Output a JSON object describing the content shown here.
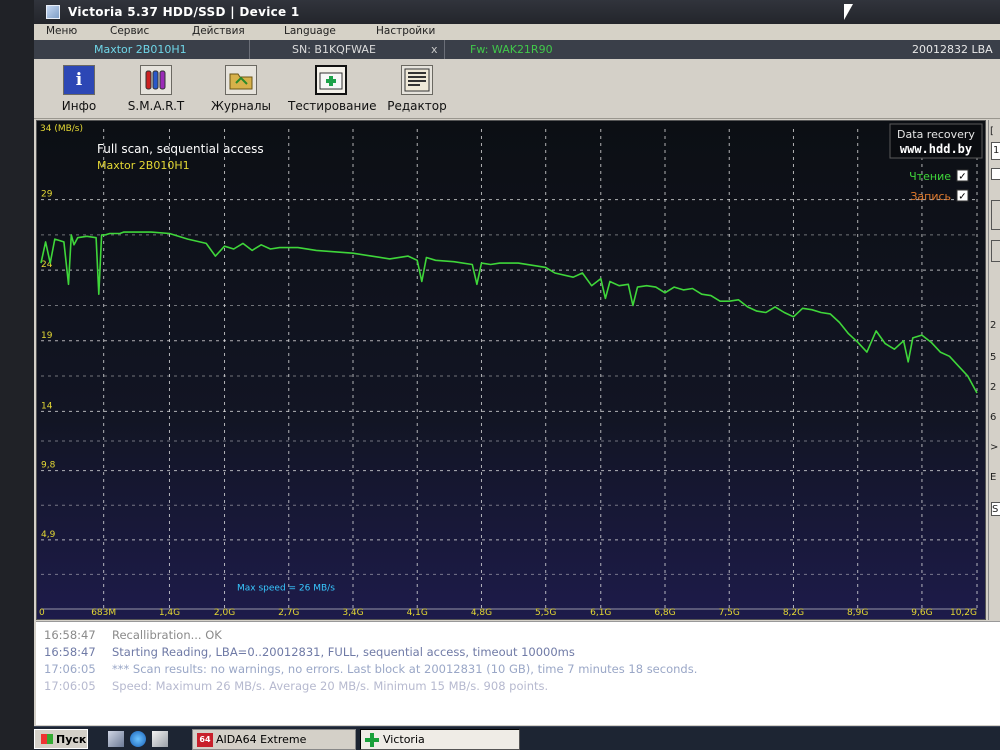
{
  "window": {
    "title": "Victoria 5.37 HDD/SSD | Device 1"
  },
  "menu": [
    "Меню",
    "Сервис",
    "Действия",
    "Language",
    "Настройки"
  ],
  "device": {
    "model": "Maxtor 2B010H1",
    "serial": "SN: B1KQFWAE",
    "serial_close": "x",
    "firmware": "Fw: WAK21R90",
    "lba": "20012832 LBA"
  },
  "toolbar": {
    "info": "Инфо",
    "smart": "S.M.A.R.T",
    "journals": "Журналы",
    "testing": "Тестирование",
    "editor": "Редактор"
  },
  "graph": {
    "title": "Full scan, sequential access",
    "subtitle": "Maxtor 2B010H1",
    "unit_label": "34 (MB/s)",
    "brand_line1": "Data recovery",
    "brand_line2": "www.hdd.by",
    "legend_read": "Чтение",
    "legend_write": "Запись",
    "max_speed": "Max speed = 26 MB/s",
    "check_mark": "✓"
  },
  "chart_data": {
    "type": "line",
    "ylabel": "34 (MB/s)",
    "ylim": [
      0,
      34
    ],
    "y_ticks": [
      "29",
      "24",
      "19",
      "14",
      "9,8",
      "4,9"
    ],
    "y_tick_values": [
      29,
      24,
      19,
      14,
      9.8,
      4.9
    ],
    "x_ticks": [
      "0",
      "683M",
      "1,4G",
      "2,0G",
      "2,7G",
      "3,4G",
      "4,1G",
      "4,8G",
      "5,5G",
      "6,1G",
      "6,8G",
      "7,5G",
      "8,2G",
      "8,9G",
      "9,6G",
      "10,2G"
    ],
    "x_tick_values": [
      0,
      0.683,
      1.4,
      2.0,
      2.7,
      3.4,
      4.1,
      4.8,
      5.5,
      6.1,
      6.8,
      7.5,
      8.2,
      8.9,
      9.6,
      10.2
    ],
    "xlim": [
      0,
      10.2
    ],
    "grid": true,
    "series": [
      {
        "name": "Чтение",
        "color": "#3fd63a",
        "x": [
          0,
          0.05,
          0.1,
          0.15,
          0.25,
          0.3,
          0.33,
          0.36,
          0.4,
          0.5,
          0.6,
          0.63,
          0.66,
          0.7,
          0.75,
          0.78,
          0.8,
          0.83,
          0.86,
          0.9,
          1.0,
          1.2,
          1.4,
          1.6,
          1.8,
          1.9,
          2.0,
          2.1,
          2.2,
          2.3,
          2.4,
          2.5,
          2.6,
          2.8,
          3.0,
          3.2,
          3.4,
          3.6,
          3.8,
          4.0,
          4.1,
          4.15,
          4.2,
          4.3,
          4.5,
          4.7,
          4.75,
          4.8,
          4.9,
          5.0,
          5.2,
          5.4,
          5.5,
          5.6,
          5.8,
          5.9,
          6.0,
          6.1,
          6.15,
          6.2,
          6.3,
          6.4,
          6.45,
          6.5,
          6.6,
          6.7,
          6.8,
          6.9,
          7.0,
          7.1,
          7.2,
          7.3,
          7.4,
          7.5,
          7.6,
          7.7,
          7.8,
          7.9,
          8.0,
          8.1,
          8.2,
          8.3,
          8.4,
          8.5,
          8.6,
          8.7,
          8.8,
          8.9,
          9.0,
          9.1,
          9.2,
          9.3,
          9.4,
          9.45,
          9.5,
          9.6,
          9.7,
          9.8,
          9.9,
          10.0,
          10.1,
          10.2
        ],
        "y": [
          24.5,
          26.0,
          24.5,
          26.2,
          26.0,
          23.0,
          26.5,
          25.8,
          26.3,
          26.4,
          26.3,
          22.3,
          26.5,
          26.5,
          26.6,
          26.6,
          26.6,
          26.6,
          26.6,
          26.7,
          26.7,
          26.7,
          26.6,
          26.2,
          25.9,
          25.0,
          25.7,
          25.5,
          25.9,
          25.4,
          25.8,
          25.5,
          25.6,
          25.6,
          25.4,
          25.3,
          25.2,
          25.0,
          24.8,
          25.0,
          24.7,
          23.2,
          24.9,
          24.7,
          24.6,
          24.4,
          23.0,
          24.5,
          24.4,
          24.5,
          24.5,
          24.3,
          24.2,
          23.8,
          23.5,
          23.8,
          22.9,
          23.4,
          22.0,
          23.2,
          22.9,
          23.0,
          21.5,
          22.8,
          22.9,
          22.8,
          22.4,
          22.8,
          22.6,
          22.7,
          22.3,
          22.2,
          21.8,
          21.8,
          21.9,
          21.4,
          21.1,
          21.0,
          21.4,
          21.0,
          20.7,
          21.3,
          21.2,
          21.0,
          20.9,
          20.3,
          19.5,
          18.9,
          18.2,
          19.7,
          18.8,
          18.4,
          19.0,
          17.5,
          19.2,
          19.4,
          18.9,
          18.2,
          17.9,
          17.2,
          16.5,
          15.3
        ]
      }
    ]
  },
  "right_panel": [
    "[",
    "1",
    "",
    "",
    "2",
    "5",
    "2",
    "6",
    ">",
    "E",
    "S"
  ],
  "log": [
    {
      "time": "16:58:47",
      "text": "Recallibration... OK",
      "color": "#8a8a8a"
    },
    {
      "time": "16:58:47",
      "text": "Starting Reading, LBA=0..20012831, FULL, sequential access, timeout 10000ms",
      "color": "#6f7aa6"
    },
    {
      "time": "17:06:05",
      "text": "*** Scan results: no warnings, no errors. Last block at 20012831 (10 GB), time 7 minutes 18 seconds.",
      "color": "#9aa7c7"
    },
    {
      "time": "17:06:05",
      "text": "Speed: Maximum 26 MB/s. Average 20 MB/s. Minimum 15 MB/s. 908 points.",
      "color": "#b6b9cf"
    }
  ],
  "taskbar": {
    "start": "Пуск",
    "aida_badge": "64",
    "aida": "AIDA64 Extreme",
    "victoria": "Victoria"
  },
  "colors": {
    "graph_bg": "#10131a",
    "grid": "#e8e8e8",
    "read": "#3fd63a",
    "write": "#e07a2e",
    "title_text": "#ffffff",
    "yellow_text": "#e4d834",
    "max_speed_text": "#38c8ff"
  }
}
